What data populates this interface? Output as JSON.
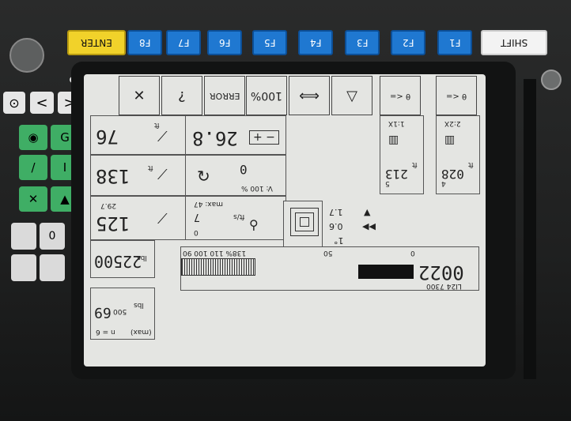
{
  "keys": {
    "shift": "SHIFT",
    "enter": "ENTER",
    "f_keys": [
      "F1",
      "F2",
      "F3",
      "F4",
      "F5",
      "F6",
      "F7",
      "F8"
    ]
  },
  "top_icons": [
    "ERROR",
    "100%"
  ],
  "boom": {
    "length_value": "76",
    "length_unit": "ft",
    "angle_value": "138",
    "angle_unit": "ft",
    "radius_value": "125",
    "radius_top": "29.7"
  },
  "battery": {
    "value": "26.8"
  },
  "slew": {
    "zero": "0",
    "pct": "V: 100 %"
  },
  "wind": {
    "value": "7",
    "max_label": "max: 47",
    "unit": "ft/s",
    "bottom": "0"
  },
  "load_a": {
    "value": "22500",
    "unit": "lbs"
  },
  "load_b": {
    "value": "69",
    "sub": "500",
    "unit": "lbs",
    "max": "(max)",
    "n": "n = 6"
  },
  "target": {
    "v1": "1.7",
    "v2": "0.6",
    "deg": "1°"
  },
  "bar": {
    "scale": "138% 110 100 90",
    "mid": "50",
    "zero": "0"
  },
  "lift": {
    "value": "0022",
    "code": "LI24 7300"
  },
  "ratios": {
    "left": "1:1X",
    "right": "2:2X"
  },
  "heights": {
    "left": "213",
    "left_sub": "5",
    "right": "028",
    "right_sub": "4",
    "unit": "ft"
  },
  "theta": {
    "left": "θ <=",
    "right": "θ <="
  }
}
